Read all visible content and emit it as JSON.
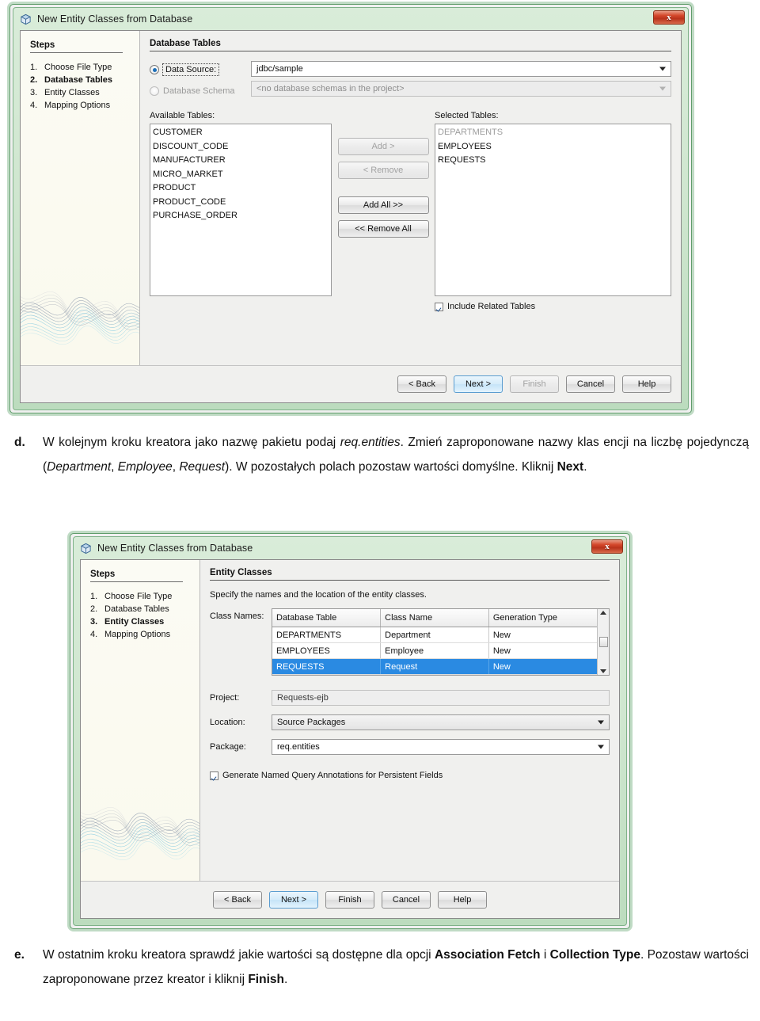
{
  "dialog1": {
    "title": "New Entity Classes from Database",
    "close_label": "x",
    "icon": "cube-icon",
    "steps_heading": "Steps",
    "steps": [
      {
        "num": "1.",
        "label": "Choose File Type",
        "active": false
      },
      {
        "num": "2.",
        "label": "Database Tables",
        "active": true
      },
      {
        "num": "3.",
        "label": "Entity Classes",
        "active": false
      },
      {
        "num": "4.",
        "label": "Mapping Options",
        "active": false
      }
    ],
    "pane_heading": "Database Tables",
    "data_source_label": "Data Source:",
    "data_source_value": "jdbc/sample",
    "database_schema_label": "Database Schema",
    "database_schema_value": "<no database schemas in the project>",
    "available_label": "Available Tables:",
    "available_tables": [
      "CUSTOMER",
      "DISCOUNT_CODE",
      "MANUFACTURER",
      "MICRO_MARKET",
      "PRODUCT",
      "PRODUCT_CODE",
      "PURCHASE_ORDER"
    ],
    "transfer_buttons": [
      {
        "label": "Add >",
        "disabled": true
      },
      {
        "label": "< Remove",
        "disabled": true
      },
      {
        "label": "Add All >>",
        "disabled": false
      },
      {
        "label": "<< Remove All",
        "disabled": false
      }
    ],
    "selected_label": "Selected Tables:",
    "selected_tables": [
      {
        "name": "DEPARTMENTS",
        "dimmed": true
      },
      {
        "name": "EMPLOYEES",
        "dimmed": false
      },
      {
        "name": "REQUESTS",
        "dimmed": false
      }
    ],
    "include_related_label": "Include Related Tables",
    "buttons": [
      {
        "label": "< Back",
        "state": "normal"
      },
      {
        "label": "Next >",
        "state": "primary"
      },
      {
        "label": "Finish",
        "state": "disabled"
      },
      {
        "label": "Cancel",
        "state": "normal"
      },
      {
        "label": "Help",
        "state": "normal"
      }
    ]
  },
  "dialog2": {
    "title": "New Entity Classes from Database",
    "close_label": "x",
    "icon": "cube-icon",
    "steps_heading": "Steps",
    "steps": [
      {
        "num": "1.",
        "label": "Choose File Type",
        "active": false
      },
      {
        "num": "2.",
        "label": "Database Tables",
        "active": false
      },
      {
        "num": "3.",
        "label": "Entity Classes",
        "active": true
      },
      {
        "num": "4.",
        "label": "Mapping Options",
        "active": false
      }
    ],
    "pane_heading": "Entity Classes",
    "description": "Specify the names and the location of the entity classes.",
    "class_names_label": "Class Names:",
    "table": {
      "columns": [
        "Database Table",
        "Class Name",
        "Generation Type"
      ],
      "rows": [
        {
          "cells": [
            "DEPARTMENTS",
            "Department",
            "New"
          ],
          "selected": false
        },
        {
          "cells": [
            "EMPLOYEES",
            "Employee",
            "New"
          ],
          "selected": false
        },
        {
          "cells": [
            "REQUESTS",
            "Request",
            "New"
          ],
          "selected": true
        }
      ]
    },
    "project_label": "Project:",
    "project_value": "Requests-ejb",
    "location_label": "Location:",
    "location_value": "Source Packages",
    "package_label": "Package:",
    "package_value": "req.entities",
    "generate_named_query_label": "Generate Named Query Annotations for Persistent Fields",
    "buttons": [
      {
        "label": "< Back",
        "state": "normal"
      },
      {
        "label": "Next >",
        "state": "primary"
      },
      {
        "label": "Finish",
        "state": "normal"
      },
      {
        "label": "Cancel",
        "state": "normal"
      },
      {
        "label": "Help",
        "state": "normal"
      }
    ]
  },
  "prose": {
    "item_d_marker": "d.",
    "item_e_marker": "e."
  },
  "colors": {
    "window_border_green": "#5f9c6a",
    "titlebar_green": "#cfe6cf",
    "selection_blue": "#2a8ae2",
    "close_red": "#d4482b",
    "primary_button_blue": "#5b9dd0"
  }
}
